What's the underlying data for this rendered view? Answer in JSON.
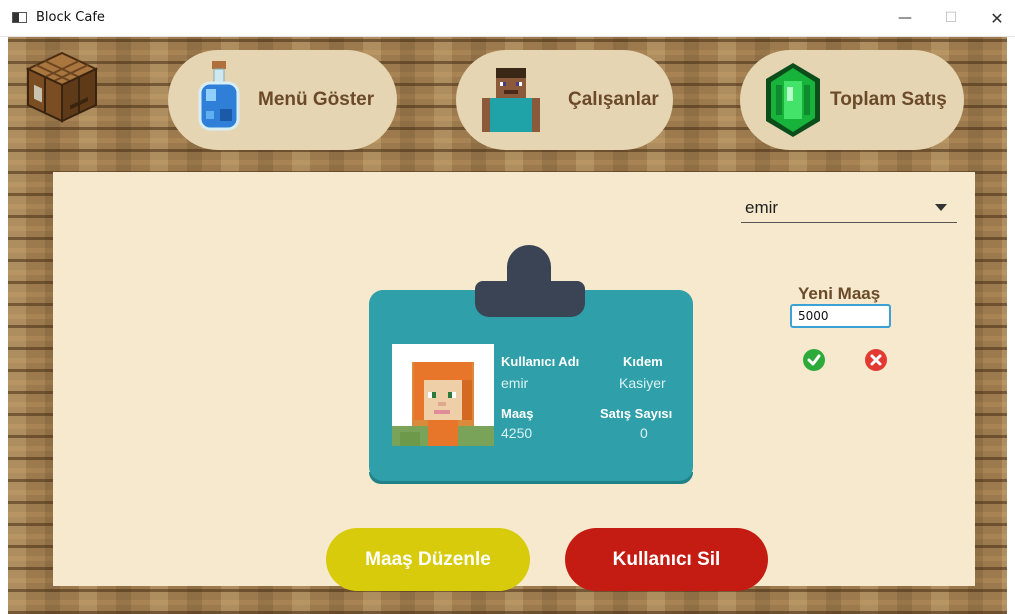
{
  "window": {
    "title": "Block Cafe",
    "controls": {
      "minimize": "—",
      "maximize": "☐",
      "close": "✕"
    }
  },
  "nav": {
    "menu_label": "Menü Göster",
    "staff_label": "Çalışanlar",
    "sales_label": "Toplam Satış"
  },
  "user_select": {
    "selected": "emir"
  },
  "badge": {
    "username_label": "Kullanıcı Adı",
    "username_value": "emir",
    "seniority_label": "Kıdem",
    "seniority_value": "Kasiyer",
    "salary_label": "Maaş",
    "salary_value": "4250",
    "sales_label": "Satış Sayısı",
    "sales_value": "0"
  },
  "salary_edit": {
    "label": "Yeni Maaş",
    "input_value": "5000"
  },
  "actions": {
    "edit_salary": "Maaş Düzenle",
    "delete_user": "Kullanıcı Sil"
  },
  "colors": {
    "wood": "#9c7a4e",
    "panel": "#f6e9cd",
    "badge": "#2f9fa9",
    "edit_button": "#d7cb0c",
    "delete_button": "#c41c12",
    "confirm": "#2eaa3b",
    "cancel": "#e23a32"
  }
}
